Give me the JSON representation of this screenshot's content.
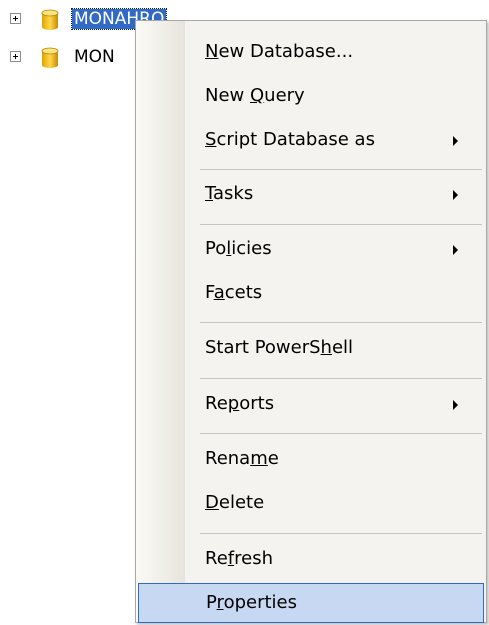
{
  "tree": {
    "nodes": [
      {
        "label": "MONAHRO",
        "selected": true,
        "icon": "database-icon"
      },
      {
        "label": "MON",
        "selected": false,
        "icon": "database-icon"
      }
    ]
  },
  "menu": {
    "items": [
      {
        "pre": "",
        "mn": "N",
        "post": "ew Database...",
        "submenu": false
      },
      {
        "pre": "New ",
        "mn": "Q",
        "post": "uery",
        "submenu": false
      },
      {
        "pre": "",
        "mn": "S",
        "post": "cript Database as",
        "submenu": true
      },
      {
        "pre": "",
        "mn": "T",
        "post": "asks",
        "submenu": true
      },
      {
        "pre": "Po",
        "mn": "l",
        "post": "icies",
        "submenu": true
      },
      {
        "pre": "F",
        "mn": "a",
        "post": "cets",
        "submenu": false
      },
      {
        "pre": "Start PowerS",
        "mn": "h",
        "post": "ell",
        "submenu": false
      },
      {
        "pre": "Re",
        "mn": "p",
        "post": "orts",
        "submenu": true
      },
      {
        "pre": "Rena",
        "mn": "m",
        "post": "e",
        "submenu": false
      },
      {
        "pre": "",
        "mn": "D",
        "post": "elete",
        "submenu": false
      },
      {
        "pre": "Re",
        "mn": "f",
        "post": "resh",
        "submenu": false
      },
      {
        "pre": "P",
        "mn": "r",
        "post": "operties",
        "submenu": false
      }
    ]
  },
  "colors": {
    "selection": "#316ac5",
    "hover": "#c7d8f2",
    "menu_background": "#f4f3ef"
  }
}
